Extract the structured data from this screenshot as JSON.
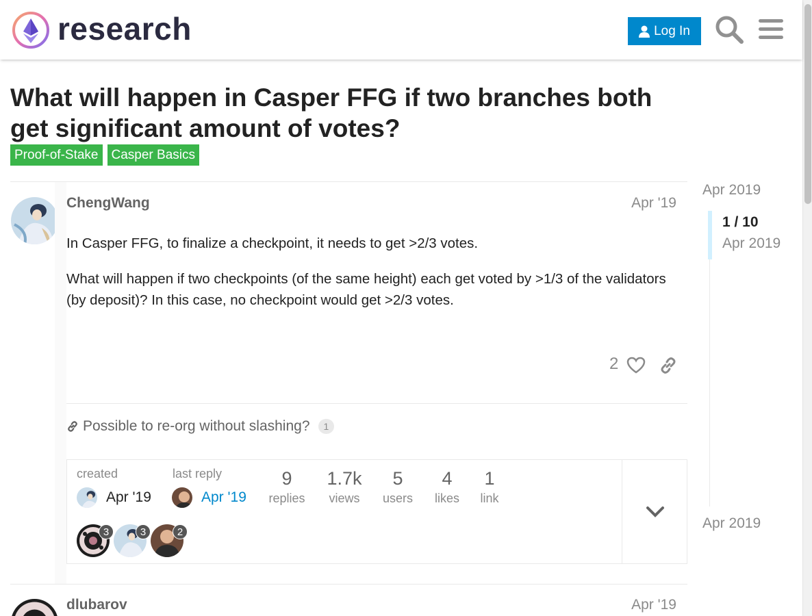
{
  "header": {
    "site_name": "research",
    "login_label": "Log In",
    "search_icon": "search-icon",
    "menu_icon": "hamburger-menu-icon"
  },
  "topic": {
    "title": "What will happen in Casper FFG if two branches both get significant amount of votes?",
    "tags": [
      "Proof-of-Stake",
      "Casper Basics"
    ],
    "tag_color": "#3ab54a"
  },
  "post1": {
    "username": "ChengWang",
    "date": "Apr '19",
    "paragraphs": [
      "In Casper FFG, to finalize a checkpoint, it needs to get >2/3 votes.",
      "What will happen if two checkpoints (of the same height) each get voted by >1/3 of the validators (by deposit)? In this case, no checkpoint would get >2/3 votes."
    ],
    "likes": "2",
    "linked_topic": "Possible to re-org without slashing?",
    "linked_count": "1"
  },
  "topic_map": {
    "created_label": "created",
    "created_date": "Apr '19",
    "last_reply_label": "last reply",
    "last_reply_date": "Apr '19",
    "stats": [
      {
        "num": "9",
        "label": "replies"
      },
      {
        "num": "1.7k",
        "label": "views"
      },
      {
        "num": "5",
        "label": "users"
      },
      {
        "num": "4",
        "label": "likes"
      },
      {
        "num": "1",
        "label": "link"
      }
    ],
    "posters": [
      {
        "count": "3"
      },
      {
        "count": "3"
      },
      {
        "count": "2"
      }
    ]
  },
  "post2": {
    "username": "dlubarov",
    "date": "Apr '19"
  },
  "timeline": {
    "start": "Apr 2019",
    "position": "1 / 10",
    "position_date": "Apr 2019",
    "end": "Apr 2019"
  },
  "colors": {
    "accent": "#0088cc",
    "timeline_handle": "#d1f0ff"
  }
}
